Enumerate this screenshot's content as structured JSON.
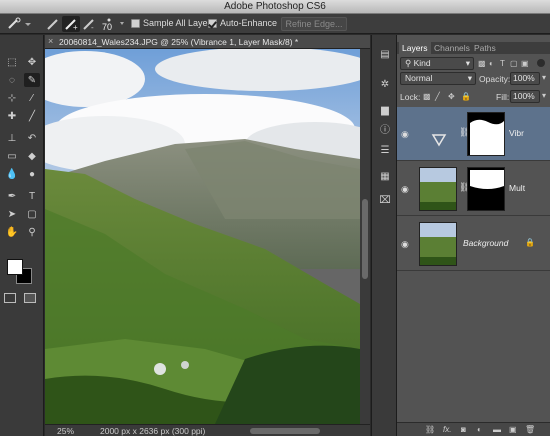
{
  "window": {
    "title": "Adobe Photoshop CS6"
  },
  "options": {
    "brush_size": "70",
    "sample_all_layers_label": "Sample All Layers",
    "sample_all_layers_checked": false,
    "auto_enhance_label": "Auto-Enhance",
    "auto_enhance_checked": true,
    "refine_edge_label": "Refine Edge..."
  },
  "document": {
    "tab_title": "20060814_Wales234.JPG @ 25% (Vibrance 1, Layer Mask/8) *",
    "close_glyph": "×",
    "zoom": "25%",
    "info": "2000 px x 2636 px (300 ppi)"
  },
  "tools": [
    {
      "icon": "marquee-icon",
      "glyph": "⬚"
    },
    {
      "icon": "move-icon",
      "glyph": "✥"
    },
    {
      "icon": "lasso-icon",
      "glyph": "◌"
    },
    {
      "icon": "quick-selection-icon",
      "glyph": "✎"
    },
    {
      "icon": "crop-icon",
      "glyph": "⊹"
    },
    {
      "icon": "eyedropper-icon",
      "glyph": "⁄"
    },
    {
      "icon": "healing-brush-icon",
      "glyph": "✚"
    },
    {
      "icon": "brush-icon",
      "glyph": "╱"
    },
    {
      "icon": "clone-stamp-icon",
      "glyph": "⊥"
    },
    {
      "icon": "history-brush-icon",
      "glyph": "↶"
    },
    {
      "icon": "eraser-icon",
      "glyph": "▭"
    },
    {
      "icon": "paint-bucket-icon",
      "glyph": "◆"
    },
    {
      "icon": "blur-icon",
      "glyph": "💧"
    },
    {
      "icon": "dodge-icon",
      "glyph": "●"
    },
    {
      "icon": "pen-icon",
      "glyph": "✒"
    },
    {
      "icon": "type-icon",
      "glyph": "T"
    },
    {
      "icon": "path-selection-icon",
      "glyph": "➤"
    },
    {
      "icon": "shape-icon",
      "glyph": "▢"
    },
    {
      "icon": "hand-icon",
      "glyph": "✋"
    },
    {
      "icon": "zoom-icon",
      "glyph": "⚲"
    }
  ],
  "panel": {
    "tabs": [
      "Layers",
      "Channels",
      "Paths"
    ],
    "kind_label": "Kind",
    "blend_mode": "Normal",
    "opacity_label": "Opacity:",
    "opacity_value": "100%",
    "lock_label": "Lock:",
    "fill_label": "Fill:",
    "fill_value": "100%",
    "layers": [
      {
        "name": "Vibr",
        "selected": true
      },
      {
        "name": "Mult",
        "selected": false
      },
      {
        "name": "Background",
        "selected": false
      }
    ],
    "footer_icons": [
      "link-icon",
      "fx-icon",
      "mask-icon",
      "adjustment-icon",
      "group-icon",
      "new-layer-icon",
      "trash-icon"
    ]
  },
  "colors": {
    "selected_layer": "#5d728c",
    "panel_bg": "#535353"
  }
}
